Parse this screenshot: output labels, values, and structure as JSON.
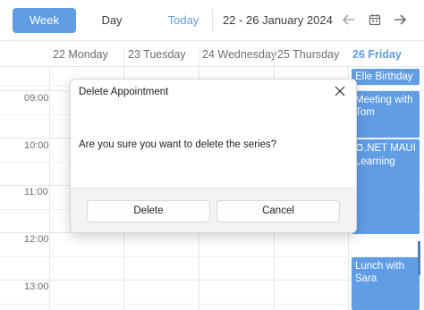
{
  "toolbar": {
    "week_label": "Week",
    "day_label": "Day",
    "today_label": "Today",
    "date_range": "22  - 26 January 2024",
    "prev_icon": "arrow-left-icon",
    "calendar_icon": "calendar-icon",
    "next_icon": "arrow-right-icon"
  },
  "days": [
    "22 Monday",
    "23 Tuesday",
    "24 Wednesday",
    "25 Thursday",
    "26 Friday"
  ],
  "today_index": 4,
  "times": [
    "09:00",
    "10:00",
    "11:00",
    "12:00",
    "13:00"
  ],
  "appointments": [
    {
      "subject": "Elle Birthday"
    },
    {
      "subject": "Meeting with Tom"
    },
    {
      "subject": ".NET MAUI Learning",
      "icon": "recurrence-icon"
    },
    {
      "subject": "Lunch with Sara"
    }
  ],
  "dialog": {
    "title": "Delete Appointment",
    "message": "Are you sure you want to delete the series?",
    "delete_label": "Delete",
    "cancel_label": "Cancel",
    "close_icon": "close-icon"
  },
  "colors": {
    "accent": "#4a90e2",
    "appointment": "#4a90e2"
  }
}
